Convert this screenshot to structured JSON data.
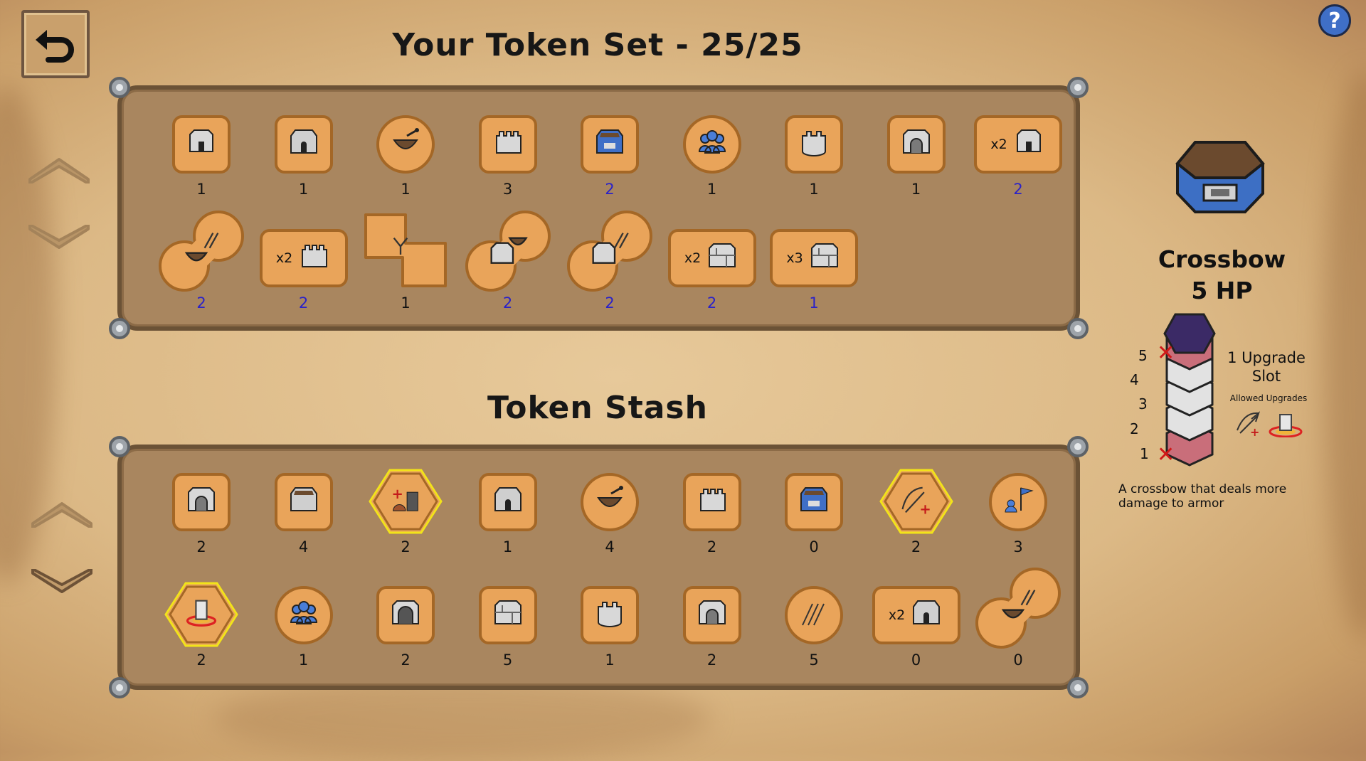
{
  "header": {
    "set_title": "Your Token Set - 25/25",
    "stash_title": "Token Stash"
  },
  "help": {
    "label": "?"
  },
  "token_set": {
    "row1": [
      {
        "icon": "wall-tower-icon",
        "shape": "square",
        "count": "1",
        "mult": "",
        "blue": false
      },
      {
        "icon": "stone-keep-icon",
        "shape": "square",
        "count": "1",
        "mult": "",
        "blue": false
      },
      {
        "icon": "cauldron-icon",
        "shape": "round",
        "count": "1",
        "mult": "",
        "blue": false
      },
      {
        "icon": "battlement-tower-icon",
        "shape": "square",
        "count": "3",
        "mult": "",
        "blue": false
      },
      {
        "icon": "blue-keep-icon",
        "shape": "square",
        "count": "2",
        "mult": "",
        "blue": true
      },
      {
        "icon": "soldiers-icon",
        "shape": "round",
        "count": "1",
        "mult": "",
        "blue": false
      },
      {
        "icon": "round-tower-icon",
        "shape": "square",
        "count": "1",
        "mult": "",
        "blue": false
      },
      {
        "icon": "gate-tower-icon",
        "shape": "square",
        "count": "1",
        "mult": "",
        "blue": false
      },
      {
        "icon": "wall-tower-icon",
        "shape": "wide",
        "count": "2",
        "mult": "x2",
        "blue": true
      }
    ],
    "row2": [
      {
        "icon": "cauldron-arrows-icon",
        "shape": "double",
        "count": "2",
        "mult": "",
        "blue": true
      },
      {
        "icon": "battlement-tower-icon",
        "shape": "wide",
        "count": "2",
        "mult": "x2",
        "blue": true
      },
      {
        "icon": "caltrops-icon",
        "shape": "cross",
        "count": "1",
        "mult": "",
        "blue": false
      },
      {
        "icon": "wall-cauldron-icon",
        "shape": "double",
        "count": "2",
        "mult": "",
        "blue": true
      },
      {
        "icon": "wall-arrows-icon",
        "shape": "double",
        "count": "2",
        "mult": "",
        "blue": true
      },
      {
        "icon": "stone-wall-icon",
        "shape": "wide",
        "count": "2",
        "mult": "x2",
        "blue": true
      },
      {
        "icon": "stone-wall-icon",
        "shape": "wide",
        "count": "1",
        "mult": "x3",
        "blue": true
      }
    ]
  },
  "stash": {
    "row1": [
      {
        "icon": "gate-tower-icon",
        "shape": "square",
        "count": "2",
        "mult": ""
      },
      {
        "icon": "open-keep-icon",
        "shape": "square",
        "count": "4",
        "mult": ""
      },
      {
        "icon": "repair-upgrade-icon",
        "shape": "hex",
        "count": "2",
        "mult": ""
      },
      {
        "icon": "stone-keep-icon",
        "shape": "square",
        "count": "1",
        "mult": ""
      },
      {
        "icon": "cauldron-icon",
        "shape": "round",
        "count": "4",
        "mult": ""
      },
      {
        "icon": "battlement-tower-icon",
        "shape": "square",
        "count": "2",
        "mult": ""
      },
      {
        "icon": "blue-keep-icon",
        "shape": "square",
        "count": "0",
        "mult": ""
      },
      {
        "icon": "crossbow-upgrade-icon",
        "shape": "hex",
        "count": "2",
        "mult": ""
      },
      {
        "icon": "banner-soldiers-icon",
        "shape": "round",
        "count": "3",
        "mult": ""
      }
    ],
    "row2": [
      {
        "icon": "tower-upgrade-icon",
        "shape": "hex",
        "count": "2",
        "mult": ""
      },
      {
        "icon": "soldiers-icon",
        "shape": "round",
        "count": "1",
        "mult": ""
      },
      {
        "icon": "arch-gate-icon",
        "shape": "square",
        "count": "2",
        "mult": ""
      },
      {
        "icon": "stone-wall-icon",
        "shape": "square",
        "count": "5",
        "mult": ""
      },
      {
        "icon": "round-tower-icon",
        "shape": "square",
        "count": "1",
        "mult": ""
      },
      {
        "icon": "gate-tower-icon",
        "shape": "square",
        "count": "2",
        "mult": ""
      },
      {
        "icon": "arrows-icon",
        "shape": "round",
        "count": "5",
        "mult": ""
      },
      {
        "icon": "stone-keep-icon",
        "shape": "wide",
        "count": "0",
        "mult": "x2"
      },
      {
        "icon": "cauldron-arrows-icon",
        "shape": "double",
        "count": "0",
        "mult": ""
      }
    ]
  },
  "preview": {
    "name": "Crossbow",
    "hp": "5 HP",
    "hp_levels": [
      "5",
      "4",
      "3",
      "2",
      "1"
    ],
    "upgrade_slots": "1 Upgrade Slot",
    "allowed_label": "Allowed Upgrades",
    "description": "A crossbow that deals more damage to armor"
  }
}
